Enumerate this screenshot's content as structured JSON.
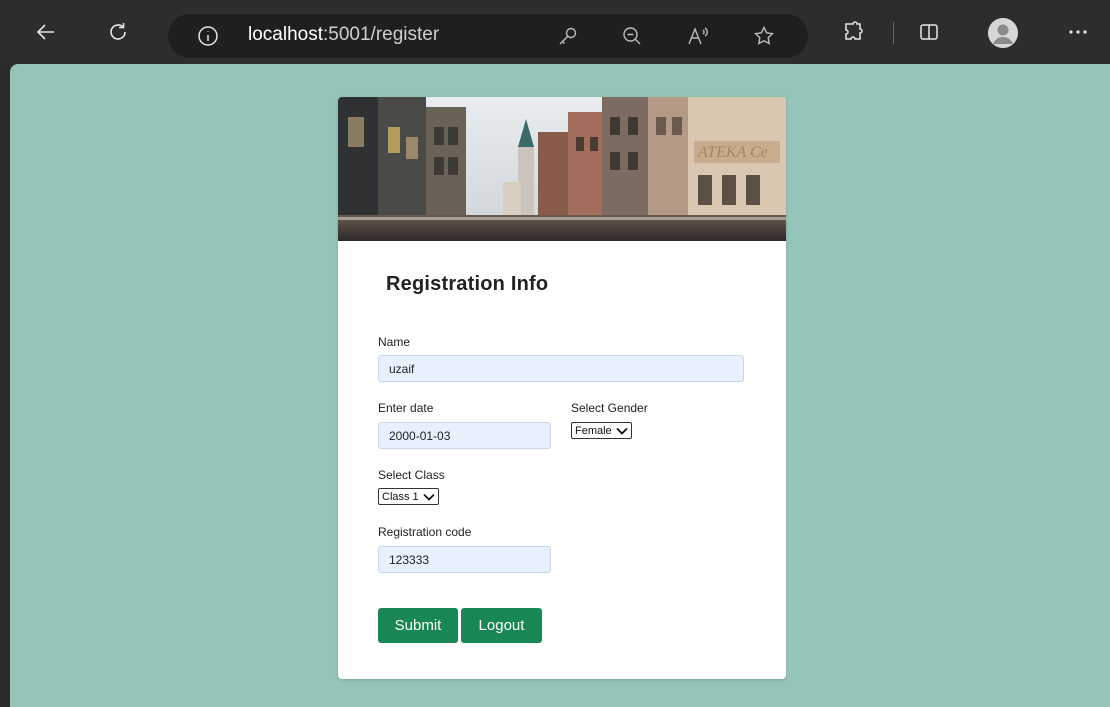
{
  "browser": {
    "url_host": "localhost",
    "url_path": ":5001/register",
    "icons": [
      "back-icon",
      "refresh-icon",
      "info-icon",
      "key-icon",
      "zoom-out-icon",
      "read-aloud-icon",
      "favorite-star-icon",
      "extensions-icon",
      "split-screen-icon",
      "profile-avatar-icon",
      "more-icon"
    ]
  },
  "form": {
    "title": "Registration Info",
    "name_label": "Name",
    "name_value": "uzaif",
    "date_label": "Enter date",
    "date_value": "2000-01-03",
    "gender_label": "Select Gender",
    "gender_value": "Female",
    "class_label": "Select Class",
    "class_value": "Class 1",
    "code_label": "Registration code",
    "code_value": "123333",
    "submit_label": "Submit",
    "logout_label": "Logout"
  },
  "colors": {
    "page_background": "#93c5b8",
    "button": "#198754",
    "input_background": "#e8f0fe"
  }
}
